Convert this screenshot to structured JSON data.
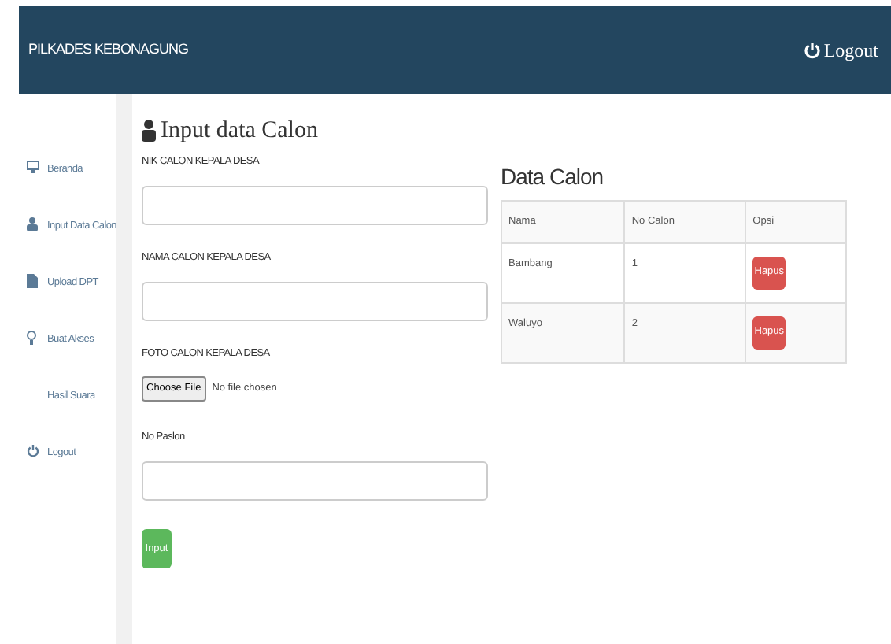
{
  "navbar": {
    "brand": "PILKADES KEBONAGUNG",
    "logout": "Logout"
  },
  "sidebar": {
    "items": [
      {
        "label": "Beranda",
        "kind": "monitor"
      },
      {
        "label": "Input Data Calon",
        "kind": "person"
      },
      {
        "label": "Upload DPT",
        "kind": "file"
      },
      {
        "label": "Buat Akses",
        "kind": "bulb"
      },
      {
        "label": "Hasil Suara",
        "kind": "none"
      },
      {
        "label": "Logout",
        "kind": "power"
      }
    ]
  },
  "form": {
    "title": "Input data Calon",
    "fields": [
      {
        "label": "NIK CALON KEPALA DESA",
        "kind": "text"
      },
      {
        "label": "NAMA CALON KEPALA DESA",
        "kind": "text"
      },
      {
        "label": "FOTO CALON KEPALA DESA",
        "kind": "file",
        "button": "Choose File",
        "status": "No file chosen"
      },
      {
        "label": "No Paslon",
        "kind": "text"
      }
    ],
    "submit": "Input"
  },
  "table": {
    "title": "Data Calon",
    "columns": [
      "Nama",
      "No Calon",
      "Opsi"
    ],
    "rows": [
      {
        "nama": "Bambang",
        "no": "1",
        "action": "Hapus"
      },
      {
        "nama": "Waluyo",
        "no": "2",
        "action": "Hapus"
      }
    ]
  }
}
